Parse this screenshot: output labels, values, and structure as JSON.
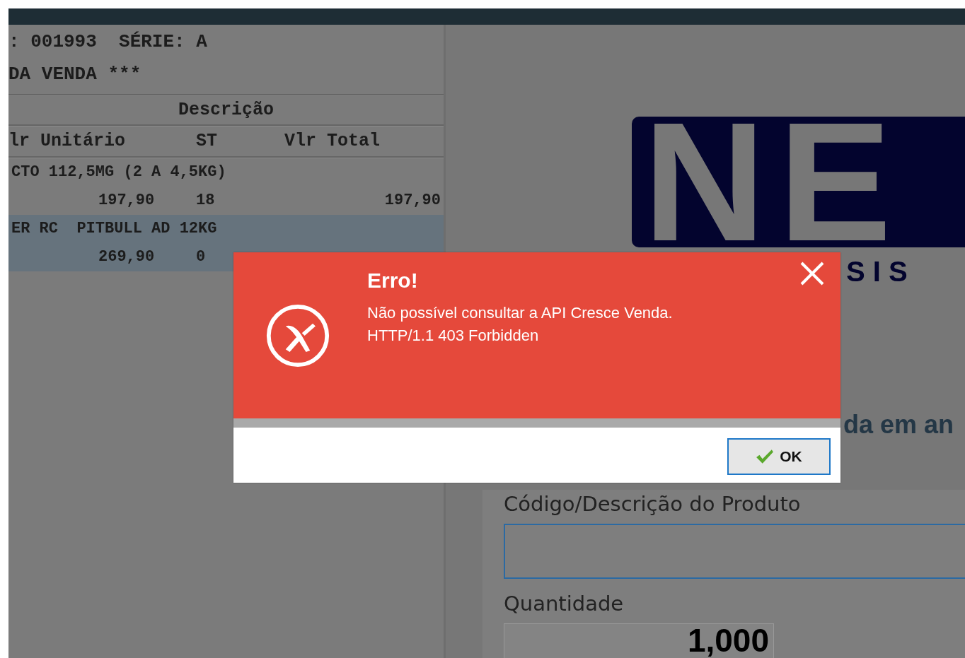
{
  "receipt": {
    "header_lines": [
      ": 001993  SÉRIE: A",
      "DA VENDA ***"
    ],
    "description_heading": "Descrição",
    "columns": [
      "lr Unitário",
      "ST",
      "Vlr Total"
    ],
    "items": [
      {
        "description": "CTO 112,5MG (2 A 4,5KG)",
        "unit_price": "197,90",
        "st": "18",
        "total": "197,90",
        "selected": false
      },
      {
        "description": "ER RC  PITBULL AD 12KG",
        "unit_price": "269,90",
        "st": "0",
        "selected": true
      }
    ]
  },
  "logo": {
    "text": "NE",
    "subtitle": "S I S"
  },
  "banner_text": "da em an",
  "product_field": {
    "label": "Código/Descrição do Produto"
  },
  "quantity_field": {
    "label": "Quantidade",
    "value": "1,000"
  },
  "dialog": {
    "title": "Erro!",
    "message_lines": [
      "Não possível consultar a API Cresce Venda.",
      "HTTP/1.1 403 Forbidden"
    ],
    "button": "OK"
  }
}
